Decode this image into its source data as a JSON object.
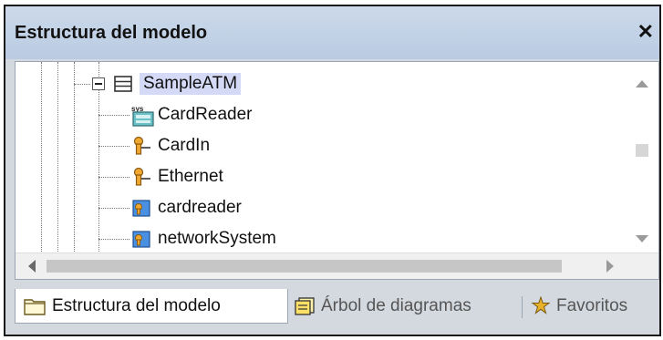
{
  "window": {
    "title": "Estructura del modelo",
    "close_glyph": "✕"
  },
  "tree": {
    "root": {
      "label": "SampleATM",
      "icon": "package-icon"
    },
    "children": [
      {
        "label": "CardReader",
        "icon": "sysml-block-icon"
      },
      {
        "label": "CardIn",
        "icon": "port-icon"
      },
      {
        "label": "Ethernet",
        "icon": "port-icon"
      },
      {
        "label": "cardreader",
        "icon": "property-icon"
      },
      {
        "label": "networkSystem",
        "icon": "property-icon"
      }
    ]
  },
  "tabs": [
    {
      "label": "Estructura del modelo",
      "icon": "folder-icon"
    },
    {
      "label": "Árbol de diagramas",
      "icon": "diagram-tree-icon"
    },
    {
      "label": "Favoritos",
      "icon": "star-icon"
    }
  ],
  "colors": {
    "title_bar": "#c4d4e8",
    "selection": "#d4daf6",
    "accent_icon": "#3a7bd5",
    "port_orange": "#d08a1e"
  }
}
